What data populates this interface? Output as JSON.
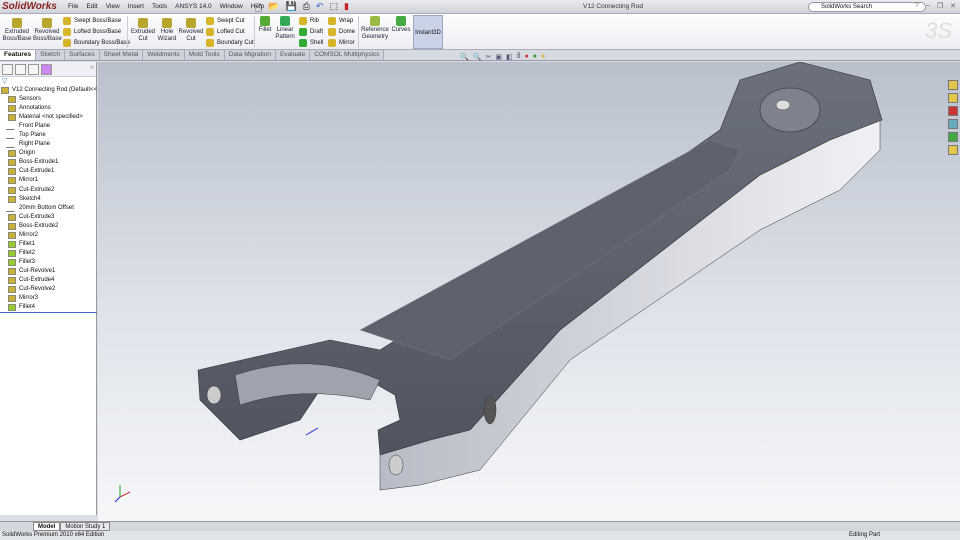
{
  "app": {
    "logo": "SolidWorks",
    "document_title": "V12 Connecting Rod",
    "search_placeholder": "SolidWorks Search"
  },
  "menu": [
    "File",
    "Edit",
    "View",
    "Insert",
    "Tools",
    "ANSYS 14.0",
    "Window",
    "Help"
  ],
  "ribbon": {
    "extruded_boss": "Extruded Boss/Base",
    "revolved_boss": "Revolved Boss/Base",
    "swept_boss": "Swept Boss/Base",
    "lofted_boss": "Lofted Boss/Base",
    "boundary_boss": "Boundary Boss/Base",
    "extruded_cut": "Extruded Cut",
    "hole_wizard": "Hole Wizard",
    "revolved_cut": "Revolved Cut",
    "swept_cut": "Swept Cut",
    "lofted_cut": "Lofted Cut",
    "boundary_cut": "Boundary Cut",
    "fillet": "Fillet",
    "linear_pattern": "Linear Pattern",
    "rib": "Rib",
    "draft": "Draft",
    "shell": "Shell",
    "wrap": "Wrap",
    "dome": "Dome",
    "mirror": "Mirror",
    "reference_geometry": "Reference Geometry",
    "curves": "Curves",
    "instant3d": "Instant3D"
  },
  "tabs": [
    "Features",
    "Sketch",
    "Surfaces",
    "Sheet Metal",
    "Weldments",
    "Mold Tools",
    "Data Migration",
    "Evaluate",
    "COMSOL Multiphysics"
  ],
  "tree": {
    "root": "V12 Connecting Rod  (Default<<",
    "items": [
      "Sensors",
      "Annotations",
      "Material <not specified>",
      "Front Plane",
      "Top Plane",
      "Right Plane",
      "Origin",
      "Boss-Extrude1",
      "Cut-Extrude1",
      "Mirror1",
      "Cut-Extrude2",
      "Sketch4",
      "20mm Bottom Offset",
      "Cut-Extrude3",
      "Boss-Extrude2",
      "Mirror2",
      "Fillet1",
      "Fillet2",
      "Fillet3",
      "Cut-Revolve1",
      "Cut-Extrude4",
      "Cut-Revolve2",
      "Mirror3",
      "Fillet4"
    ]
  },
  "model_tabs": [
    "Model",
    "Motion Study 1"
  ],
  "status": {
    "edition": "SolidWorks Premium 2010 x64 Edition",
    "mode": "Editing Part"
  },
  "colors": {
    "model": "#5a5f6b",
    "viewport_top": "#b9c0cc",
    "accent": "#4466cc"
  }
}
